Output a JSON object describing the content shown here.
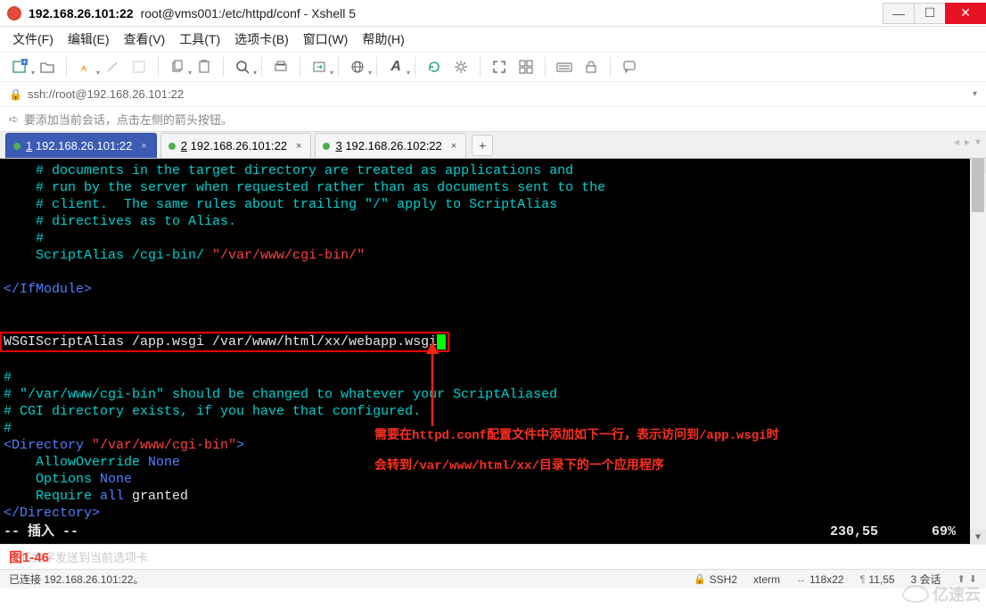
{
  "title": {
    "host": "192.168.26.101:22",
    "sub": "root@vms001:/etc/httpd/conf - Xshell 5"
  },
  "menu": {
    "file": "文件(F)",
    "edit": "编辑(E)",
    "view": "查看(V)",
    "tool": "工具(T)",
    "tab": "选项卡(B)",
    "window": "窗口(W)",
    "help": "帮助(H)"
  },
  "addr": "ssh://root@192.168.26.101:22",
  "info_tip": "要添加当前会话，点击左侧的箭头按钮。",
  "tabs": [
    {
      "num": "1",
      "label": "192.168.26.101:22",
      "active": true
    },
    {
      "num": "2",
      "label": "192.168.26.101:22",
      "active": false
    },
    {
      "num": "3",
      "label": "192.168.26.102:22",
      "active": false
    }
  ],
  "term": {
    "l1": "    # documents in the target directory are treated as applications and",
    "l2": "    # run by the server when requested rather than as documents sent to the",
    "l3": "    # client.  The same rules about trailing \"/\" apply to ScriptAlias",
    "l4": "    # directives as to Alias.",
    "l5": "    #",
    "l6a": "    ScriptAlias /cgi-bin/ ",
    "l6b": "\"/var/www/cgi-bin/\"",
    "l7": "</IfModule>",
    "l8": "WSGIScriptAlias /app.wsgi /var/www/html/xx/webapp.wsgi",
    "l9": "#",
    "l10": "# \"/var/www/cgi-bin\" should be changed to whatever your ScriptAliased",
    "l11": "# CGI directory exists, if you have that configured.",
    "l12": "#",
    "l13a": "<Directory ",
    "l13b": "\"/var/www/cgi-bin\"",
    "l13c": ">",
    "l14a": "    AllowOverride ",
    "l14b": "None",
    "l15a": "    Options ",
    "l15b": "None",
    "l16a": "    Require ",
    "l16b": "all",
    "l16c": " granted",
    "l17": "</Directory>",
    "mode": "-- 插入 --",
    "pos": "230,55",
    "pct": "69%"
  },
  "annot": {
    "line1": "需要在httpd.conf配置文件中添加如下一行，表示访问到/app.wsgi时",
    "line2": "会转到/var/www/html/xx/目录下的一个应用程序"
  },
  "lower": {
    "text": "仅将文字发送到当前选项卡",
    "label": "图1-46"
  },
  "status": {
    "conn": "已连接 192.168.26.101:22。",
    "proto": "SSH2",
    "emul": "xterm",
    "size": "118x22",
    "cursor": "11,55",
    "sessions": "3 会话"
  },
  "watermark": "亿速云"
}
